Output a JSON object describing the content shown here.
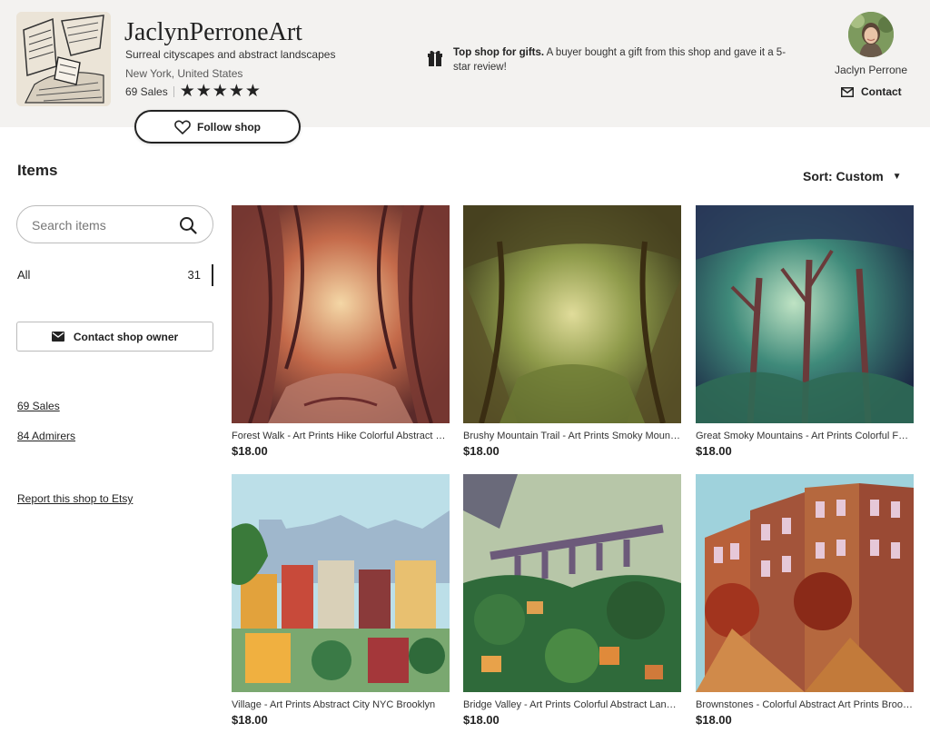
{
  "shop": {
    "name": "JaclynPerroneArt",
    "tagline": "Surreal cityscapes and abstract landscapes",
    "location": "New York, United States",
    "sales": "69 Sales",
    "rating_stars": 5,
    "follow_label": "Follow shop"
  },
  "top_shop": {
    "bold": "Top shop for gifts.",
    "text": " A buyer bought a gift from this shop and gave it a 5-star review!"
  },
  "owner": {
    "name": "Jaclyn Perrone",
    "contact_label": "Contact"
  },
  "items_section": {
    "title": "Items",
    "sort_label": "Sort: Custom",
    "search_placeholder": "Search items",
    "all_label": "All",
    "all_count": "31",
    "contact_owner_label": "Contact shop owner",
    "sales_link": "69 Sales",
    "admirers_link": "84 Admirers",
    "report_link": "Report this shop to Etsy"
  },
  "listings": [
    {
      "title": "Forest Walk - Art Prints Hike Colorful Abstract Forest",
      "price": "$18.00"
    },
    {
      "title": "Brushy Mountain Trail - Art Prints Smoky Mountains",
      "price": "$18.00"
    },
    {
      "title": "Great Smoky Mountains - Art Prints Colorful Forest",
      "price": "$18.00"
    },
    {
      "title": "Village - Art Prints Abstract City NYC Brooklyn",
      "price": "$18.00"
    },
    {
      "title": "Bridge Valley - Art Prints Colorful Abstract Landscape",
      "price": "$18.00"
    },
    {
      "title": "Brownstones - Colorful Abstract Art Prints Brooklyn",
      "price": "$18.00"
    }
  ],
  "icons": {
    "gift": "gift-icon",
    "heart": "heart-icon",
    "mail": "mail-icon",
    "search": "search-icon",
    "star": "star-icon",
    "caret": "caret-down-icon"
  }
}
